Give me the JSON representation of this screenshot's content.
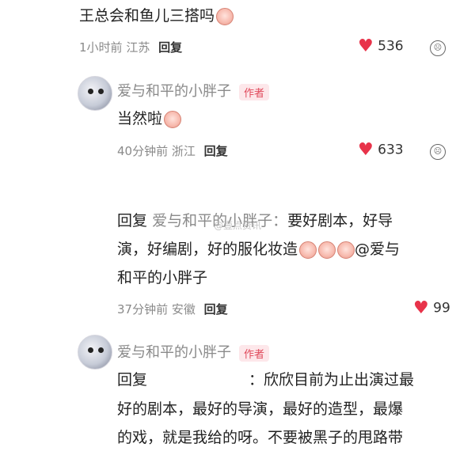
{
  "c1": {
    "text": "王总会和鱼儿三搭吗",
    "time": "1小时前",
    "location": "江苏",
    "reply_label": "回复",
    "likes": "536"
  },
  "c2": {
    "author": "爱与和平的小胖子",
    "badge": "作者",
    "text": "当然啦",
    "time": "40分钟前",
    "location": "浙江",
    "reply_label": "回复",
    "likes": "633"
  },
  "c3": {
    "reply_prefix": "回复",
    "reply_to": "爱与和平的小胖子：",
    "line1_text": "要好剧本，好导",
    "line2_text": "演，好编剧，好的服化妆造",
    "mention": "@爱与",
    "line3_text": "和平的小胖子",
    "time": "37分钟前",
    "location": "安徽",
    "reply_label": "回复",
    "likes": "99"
  },
  "c4": {
    "author": "爱与和平的小胖子",
    "badge": "作者",
    "reply_prefix": "回复",
    "line1_text": "：欣欣目前为止出演过最",
    "line2_text": "好的剧本，最好的导演，最好的造型，最爆",
    "line3_text": "的戏，就是我给的呀。不要被黑子的甩路带"
  },
  "watermark": "@壹点资讯",
  "colors": {
    "heart": "#e8334a",
    "badge_text": "#e0485a",
    "badge_bg": "#fde7ea",
    "meta": "#8a8a8a"
  },
  "icons": [
    "heart-icon",
    "dislike-icon",
    "emoji-icon",
    "avatar"
  ]
}
